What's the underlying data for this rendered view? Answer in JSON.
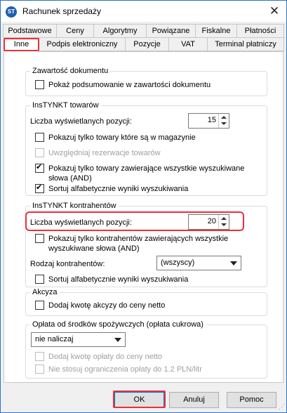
{
  "window": {
    "title": "Rachunek sprzedaży",
    "icon": "app-logo-icon",
    "close_glyph": "✕"
  },
  "tabs_row1": [
    "Podstawowe",
    "Ceny",
    "Algorytmy",
    "Powiązane",
    "Fiskalne",
    "Płatności"
  ],
  "tabs_row2": [
    "Inne",
    "Podpis elektroniczny",
    "Pozycje",
    "VAT",
    "Terminal płatniczy"
  ],
  "active_tab": "Inne",
  "zawartosc": {
    "title": "Zawartość dokumentu",
    "show_summary": {
      "label": "Pokaż podsumowanie w zawartości dokumentu",
      "checked": false
    }
  },
  "instynkt_towarow": {
    "title": "InsTYNKT towarów",
    "count_label": "Liczba wyświetlanych pozycji:",
    "count_value": "15",
    "only_in_stock": {
      "label": "Pokazuj tylko towary które są w magazynie",
      "checked": false
    },
    "reservations": {
      "label": "Uwzględniaj rezerwacje towarów",
      "checked": false,
      "disabled": true
    },
    "all_words": {
      "label": "Pokazuj tylko towary zawierające wszystkie wyszukiwane słowa (AND)",
      "checked": true
    },
    "sort_alpha": {
      "label": "Sortuj alfabetycznie wyniki wyszukiwania",
      "checked": true
    }
  },
  "instynkt_kontrahentow": {
    "title": "InsTYNKT kontrahentów",
    "count_label": "Liczba wyświetlanych pozycji:",
    "count_value": "20",
    "all_words": {
      "label": "Pokazuj tylko kontrahentów zawierających wszystkie wyszukiwane słowa (AND)",
      "checked": false
    },
    "type_label": "Rodzaj kontrahentów:",
    "type_value": "(wszyscy)",
    "sort_alpha": {
      "label": "Sortuj alfabetycznie wyniki wyszukiwania",
      "checked": false
    }
  },
  "akcyza": {
    "title": "Akcyza",
    "add_excise": {
      "label": "Dodaj kwotę akcyzy do ceny netto",
      "checked": false
    }
  },
  "oplata": {
    "title": "Opłata od środków spożywczych (opłata cukrowa)",
    "select_value": "nie naliczaj",
    "add_fee": {
      "label": "Dodaj kwotę opłaty do ceny netto",
      "checked": false,
      "disabled": true
    },
    "no_limit": {
      "label": "Nie stosuj ograniczenia opłaty do 1.2 PLN/litr",
      "checked": false,
      "disabled": true
    }
  },
  "buttons": {
    "ok": "OK",
    "cancel": "Anuluj",
    "help": "Pomoc"
  },
  "colors": {
    "highlight": "#e8313a",
    "accent": "#0078d7"
  }
}
